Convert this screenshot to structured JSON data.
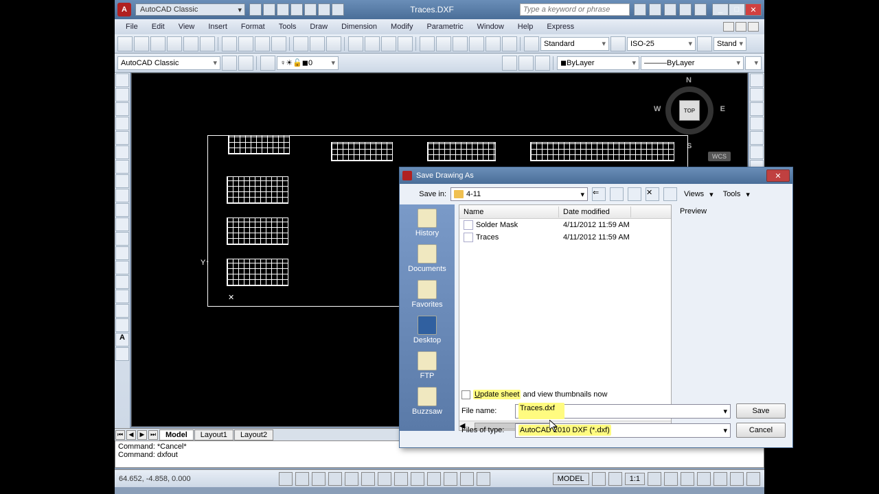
{
  "window": {
    "workspace": "AutoCAD Classic",
    "docTitle": "Traces.DXF",
    "searchPlaceholder": "Type a keyword or phrase"
  },
  "menus": [
    "File",
    "Edit",
    "View",
    "Insert",
    "Format",
    "Tools",
    "Draw",
    "Dimension",
    "Modify",
    "Parametric",
    "Window",
    "Help",
    "Express"
  ],
  "toolbar2": {
    "styleStandard": "Standard",
    "styleIso": "ISO-25",
    "styleStand2": "Stand"
  },
  "toolbar3": {
    "workspace": "AutoCAD Classic",
    "layer0": "0",
    "layerBy": "ByLayer",
    "linetype": "ByLayer"
  },
  "viewcube": {
    "top": "TOP",
    "n": "N",
    "s": "S",
    "e": "E",
    "w": "W",
    "wcs": "WCS"
  },
  "tabs": {
    "model": "Model",
    "layout1": "Layout1",
    "layout2": "Layout2"
  },
  "cmd": {
    "line1": "Command: *Cancel*",
    "line2": "Command: dxfout"
  },
  "status": {
    "coords": "64.652, -4.858, 0.000",
    "model": "MODEL",
    "scale": "1:1"
  },
  "dialog": {
    "title": "Save Drawing As",
    "saveInLabel": "Save in:",
    "folder": "4-11",
    "views": "Views",
    "tools": "Tools",
    "places": [
      "History",
      "Documents",
      "Favorites",
      "Desktop",
      "FTP",
      "Buzzsaw"
    ],
    "columns": {
      "name": "Name",
      "date": "Date modified"
    },
    "files": [
      {
        "name": "Solder Mask",
        "date": "4/11/2012 11:59 AM"
      },
      {
        "name": "Traces",
        "date": "4/11/2012 11:59 AM"
      }
    ],
    "previewLabel": "Preview",
    "updateLabel": "Update sheet and view thumbnails now",
    "fileNameLabel": "File name:",
    "fileName": "Traces.dxf",
    "fileTypeLabel": "Files of type:",
    "fileType": "AutoCAD 2010 DXF (*.dxf)",
    "save": "Save",
    "cancel": "Cancel"
  }
}
